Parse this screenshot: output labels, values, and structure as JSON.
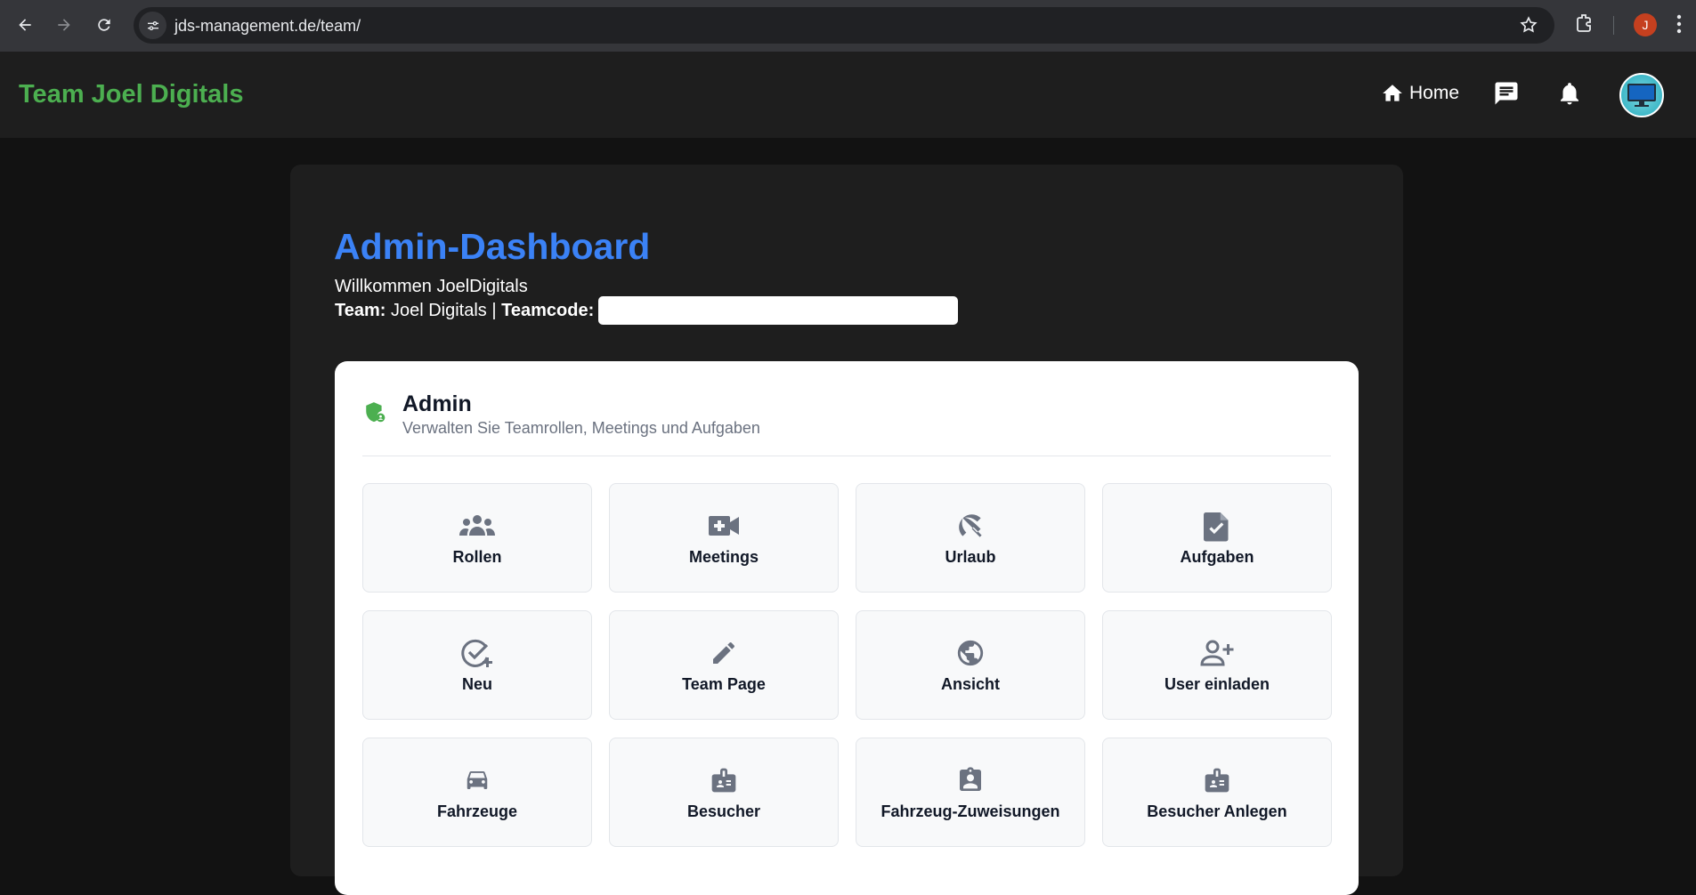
{
  "browser": {
    "url": "jds-management.de/team/",
    "profile_initial": "J"
  },
  "header": {
    "brand": "Team Joel Digitals",
    "home_label": "Home",
    "brand_color": "#4caf50"
  },
  "dashboard": {
    "title": "Admin-Dashboard",
    "welcome": "Willkommen JoelDigitals",
    "team_label": "Team:",
    "team_name": "Joel Digitals",
    "separator": "|",
    "teamcode_label": "Teamcode:",
    "teamcode_value": "",
    "title_color": "#3b82f6"
  },
  "admin_card": {
    "title": "Admin",
    "subtitle": "Verwalten Sie Teamrollen, Meetings und Aufgaben",
    "tiles": [
      {
        "label": "Rollen",
        "icon": "groups-icon"
      },
      {
        "label": "Meetings",
        "icon": "video-plus-icon"
      },
      {
        "label": "Urlaub",
        "icon": "beach-umbrella-icon"
      },
      {
        "label": "Aufgaben",
        "icon": "task-file-icon"
      },
      {
        "label": "Neu",
        "icon": "check-circle-plus-icon"
      },
      {
        "label": "Team Page",
        "icon": "pencil-icon"
      },
      {
        "label": "Ansicht",
        "icon": "globe-icon"
      },
      {
        "label": "User einladen",
        "icon": "person-add-icon"
      },
      {
        "label": "Fahrzeuge",
        "icon": "car-icon"
      },
      {
        "label": "Besucher",
        "icon": "badge-icon"
      },
      {
        "label": "Fahrzeug-Zuweisungen",
        "icon": "assignment-ind-icon"
      },
      {
        "label": "Besucher Anlegen",
        "icon": "badge-icon"
      }
    ]
  }
}
